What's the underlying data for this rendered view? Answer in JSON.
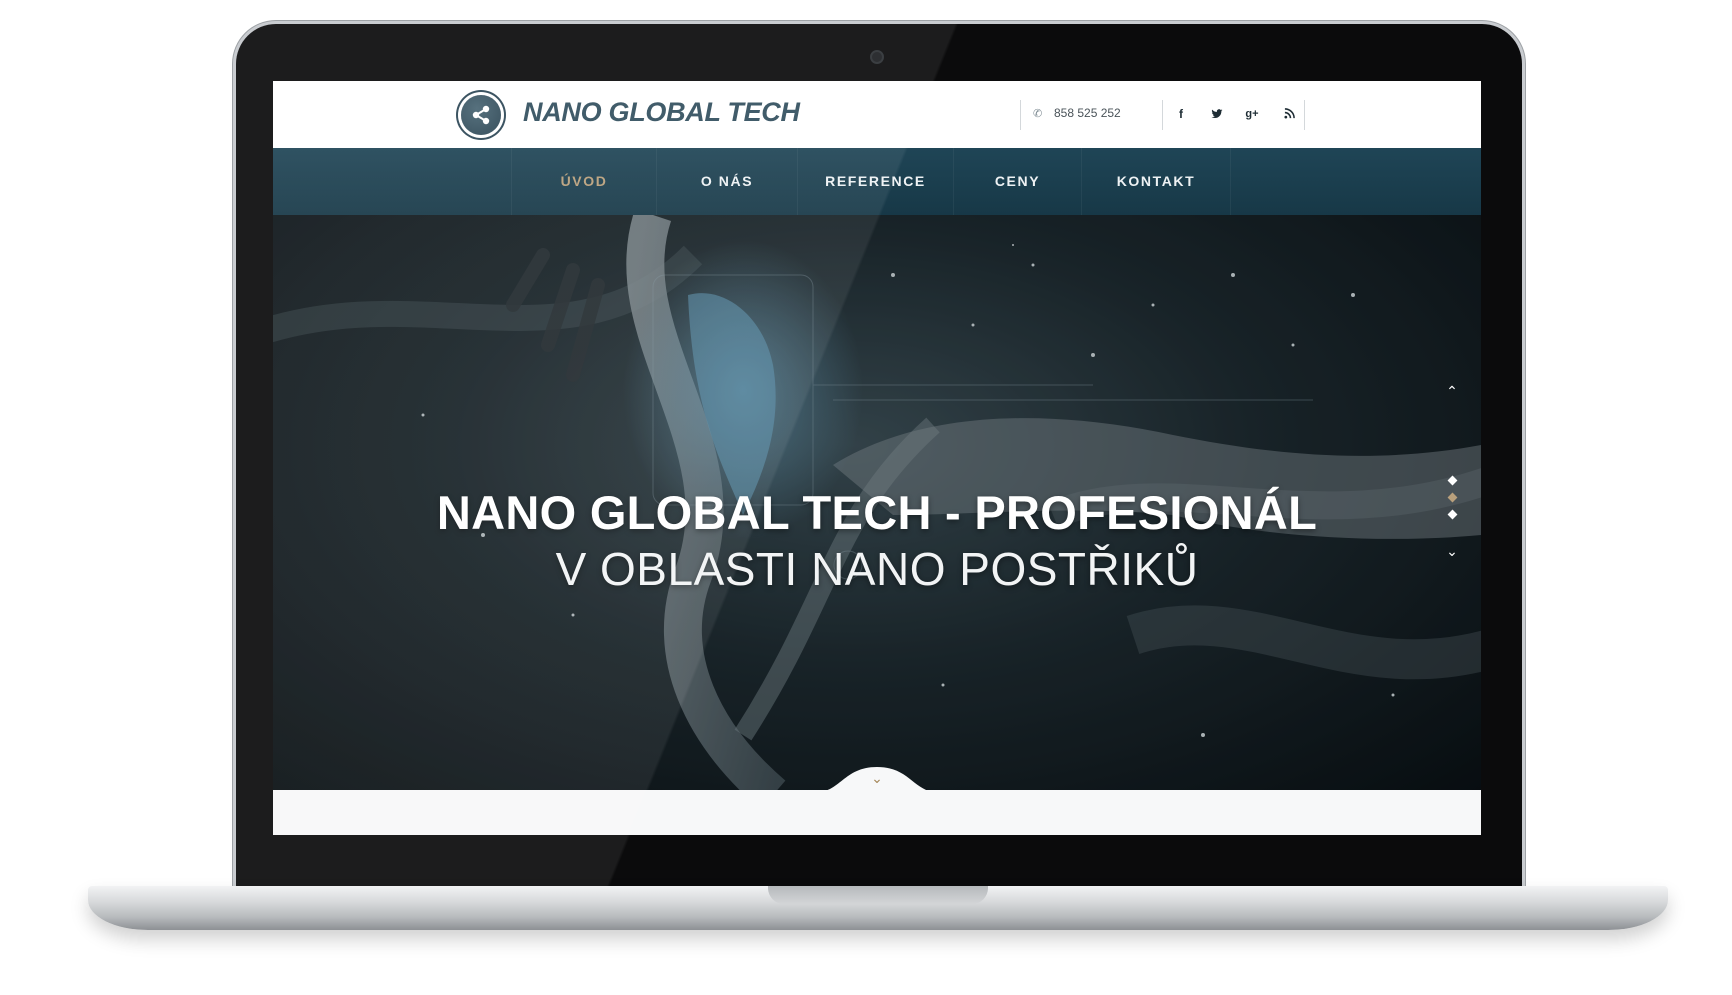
{
  "brand": {
    "name": "NANO GLOBAL TECH",
    "logo_icon": "share-nodes-icon"
  },
  "header": {
    "phone": "858 525 252",
    "phone_icon": "phone-icon",
    "social": [
      {
        "name": "facebook-icon",
        "glyph": "f"
      },
      {
        "name": "twitter-icon",
        "glyph": "t"
      },
      {
        "name": "google-plus-icon",
        "glyph": "g+"
      },
      {
        "name": "rss-icon",
        "glyph": "rss"
      }
    ]
  },
  "nav": {
    "items": [
      {
        "label": "ÚVOD",
        "active": true
      },
      {
        "label": "O NÁS",
        "active": false
      },
      {
        "label": "REFERENCE",
        "active": false
      },
      {
        "label": "CENY",
        "active": false
      },
      {
        "label": "KONTAKT",
        "active": false
      }
    ]
  },
  "hero": {
    "title": "NANO GLOBAL TECH - PROFESIONÁL",
    "subtitle": "V OBLASTI NANO POSTŘIKŮ",
    "slides_total": 3,
    "slide_active": 2
  },
  "colors": {
    "nav_bg": "#1f4556",
    "accent": "#b9a07c",
    "logo_text": "#33505f"
  }
}
